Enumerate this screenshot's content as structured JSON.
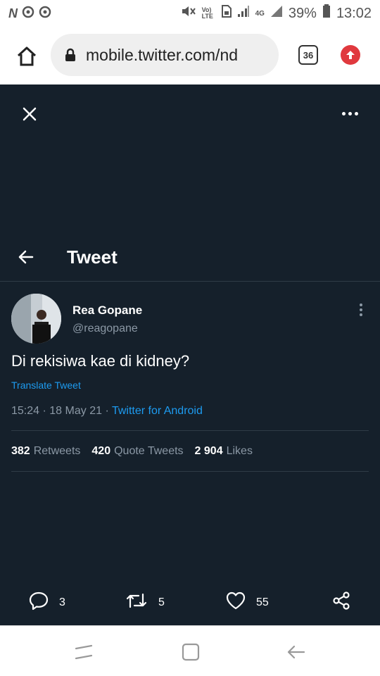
{
  "statusbar": {
    "left_letter": "N",
    "battery": "39%",
    "time": "13:02",
    "network": "4G",
    "volte": "Vo) LTE"
  },
  "browser": {
    "url": "mobile.twitter.com/nd",
    "tab_count": "36",
    "home_icon": "home-icon",
    "lock_icon": "lock-icon",
    "upload_icon": "arrow-up-circle-icon"
  },
  "header": {
    "title": "Tweet"
  },
  "tweet": {
    "author_name": "Rea Gopane",
    "author_handle": "@reagopane",
    "text": "Di rekisiwa kae di kidney?",
    "translate_label": "Translate Tweet",
    "time": "15:24",
    "date": "18 May 21",
    "source": "Twitter for Android"
  },
  "stats": {
    "retweets_count": "382",
    "retweets_label": "Retweets",
    "quotes_count": "420",
    "quotes_label": "Quote Tweets",
    "likes_count": "2 904",
    "likes_label": "Likes"
  },
  "actions": {
    "replies": "3",
    "retweets": "5",
    "likes": "55"
  },
  "colors": {
    "twitter_bg": "#15202b",
    "accent": "#1d9bf0",
    "muted": "#8b98a5",
    "upload": "#e0393e"
  }
}
